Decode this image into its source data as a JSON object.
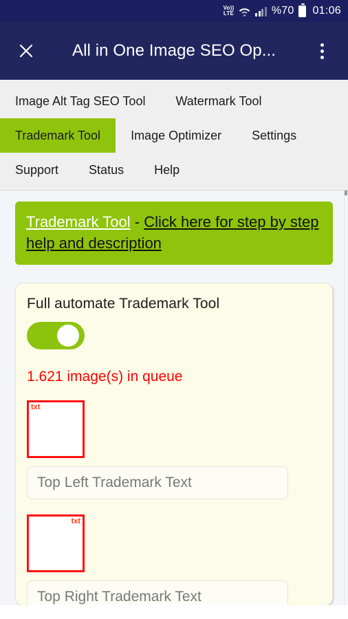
{
  "status_bar": {
    "network_label_top": "Vo))",
    "network_label_bottom": "LTE",
    "wifi_icon": "wifi-icon",
    "signal_icon": "signal-bars-icon",
    "battery_percent": "%70",
    "battery_icon": "battery-icon",
    "time": "01:06"
  },
  "app_bar": {
    "close_icon": "close-icon",
    "title": "All in One Image SEO Op...",
    "menu_icon": "overflow-menu-icon"
  },
  "nav": {
    "rows": [
      [
        {
          "label": "Image Alt Tag SEO Tool",
          "active": false
        },
        {
          "label": "Watermark Tool",
          "active": false
        }
      ],
      [
        {
          "label": "Trademark Tool",
          "active": true
        },
        {
          "label": "Image Optimizer",
          "active": false
        },
        {
          "label": "Settings",
          "active": false
        }
      ],
      [
        {
          "label": "Support",
          "active": false
        },
        {
          "label": "Status",
          "active": false
        },
        {
          "label": "Help",
          "active": false
        }
      ]
    ],
    "active_color": "#8fc40c"
  },
  "banner": {
    "link_primary": "Trademark Tool",
    "separator": "  -  ",
    "link_secondary": "Click here for step by step help and description",
    "background_color": "#8fc40c"
  },
  "card": {
    "title": "Full automate Trademark Tool",
    "toggle": {
      "name": "full-automate-toggle",
      "state": "on",
      "on_color": "#8cc40d"
    },
    "queue_text": "1.621 image(s) in queue",
    "queue_color": "#ff0000",
    "fields": [
      {
        "position_tag": "txt",
        "position_corner": "top-left",
        "placeholder": "Top Left Trademark Text",
        "value": ""
      },
      {
        "position_tag": "txt",
        "position_corner": "top-right",
        "placeholder": "Top Right Trademark Text",
        "value": ""
      }
    ],
    "background_color": "#fcfce8"
  }
}
